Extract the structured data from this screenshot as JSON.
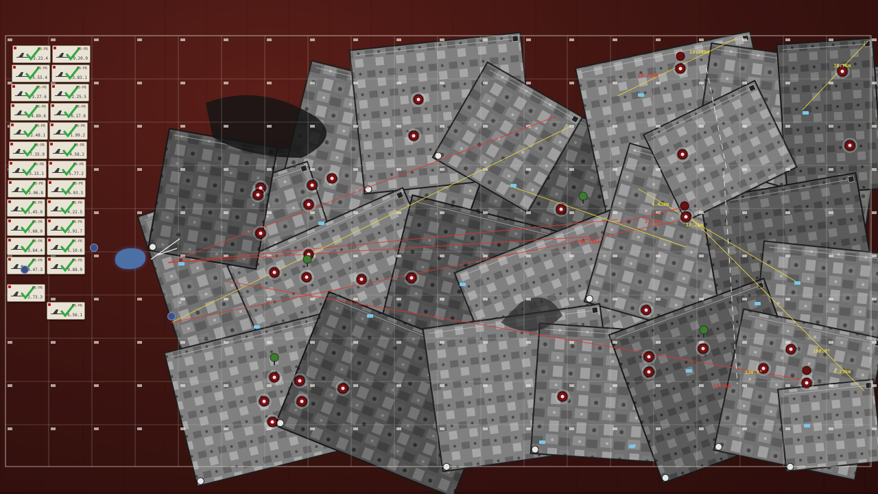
{
  "colors": {
    "background": "#3a1512",
    "grid": "#d9d0c8",
    "photo_dark": "#2b2b2b",
    "photo_light": "#9a9a9a",
    "marker_red": "#7a0f14",
    "line_red": "#e0342c",
    "line_yellow": "#e8d23a",
    "label_blue": "#79c8ea",
    "card_bg": "#e9e3d6",
    "check_green": "#35a845"
  },
  "sidebar": {
    "cards": [
      {
        "code": "F5·P6",
        "value": "2.22.4"
      },
      {
        "code": "F5·P6",
        "value": "9.20.9"
      },
      {
        "code": "F5·P6",
        "value": "5.55.4"
      },
      {
        "code": "F5·P6",
        "value": "3.83.1"
      },
      {
        "code": "F5·P6",
        "value": "3.27.6"
      },
      {
        "code": "F5·P6",
        "value": "2.25.5"
      },
      {
        "code": "F5·P6",
        "value": "4.89.6"
      },
      {
        "code": "F5·P6",
        "value": "6.17.8"
      },
      {
        "code": "F5·P6",
        "value": "2.48.1"
      },
      {
        "code": "F5·P6",
        "value": "1.99.2"
      },
      {
        "code": "F5·P6",
        "value": "7.35.9"
      },
      {
        "code": "F5·P6",
        "value": "4.58.2"
      },
      {
        "code": "F5·P6",
        "value": "3.15.1"
      },
      {
        "code": "F5·P6",
        "value": "5.77.2"
      },
      {
        "code": "F5·P6",
        "value": "2.06.8"
      },
      {
        "code": "F5·P6",
        "value": "6.03.3"
      },
      {
        "code": "F5·P6",
        "value": "1.45.9"
      },
      {
        "code": "F5·P6",
        "value": "4.22.5"
      },
      {
        "code": "F5·P6",
        "value": "7.68.0"
      },
      {
        "code": "F5·P6",
        "value": "2.91.7"
      },
      {
        "code": "F5·P6",
        "value": "3.64.4"
      },
      {
        "code": "F5·P6",
        "value": "5.10.6"
      },
      {
        "code": "F5·P6",
        "value": "4.47.3"
      },
      {
        "code": "F5·P6",
        "value": "9.88.9"
      },
      {
        "code": "F5·P6",
        "value": "2.73.3"
      },
      {
        "code": "F5·P6",
        "value": "6.56.1"
      }
    ]
  },
  "map": {
    "line_labels": [
      {
        "text": "10.18km",
        "color": "line_yellow"
      },
      {
        "text": "20.29km",
        "color": "line_red"
      },
      {
        "text": "100.0°",
        "color": "line_yellow"
      },
      {
        "text": "38.7km",
        "color": "line_yellow"
      },
      {
        "text": "4.43km",
        "color": "line_yellow"
      },
      {
        "text": "33.3km",
        "color": "line_red"
      },
      {
        "text": "10.2km",
        "color": "line_yellow"
      },
      {
        "text": "38.13km",
        "color": "line_red"
      },
      {
        "text": "130.7°",
        "color": "line_yellow"
      },
      {
        "text": "4.25km",
        "color": "line_yellow"
      },
      {
        "text": "18.8km",
        "color": "line_red"
      }
    ]
  }
}
